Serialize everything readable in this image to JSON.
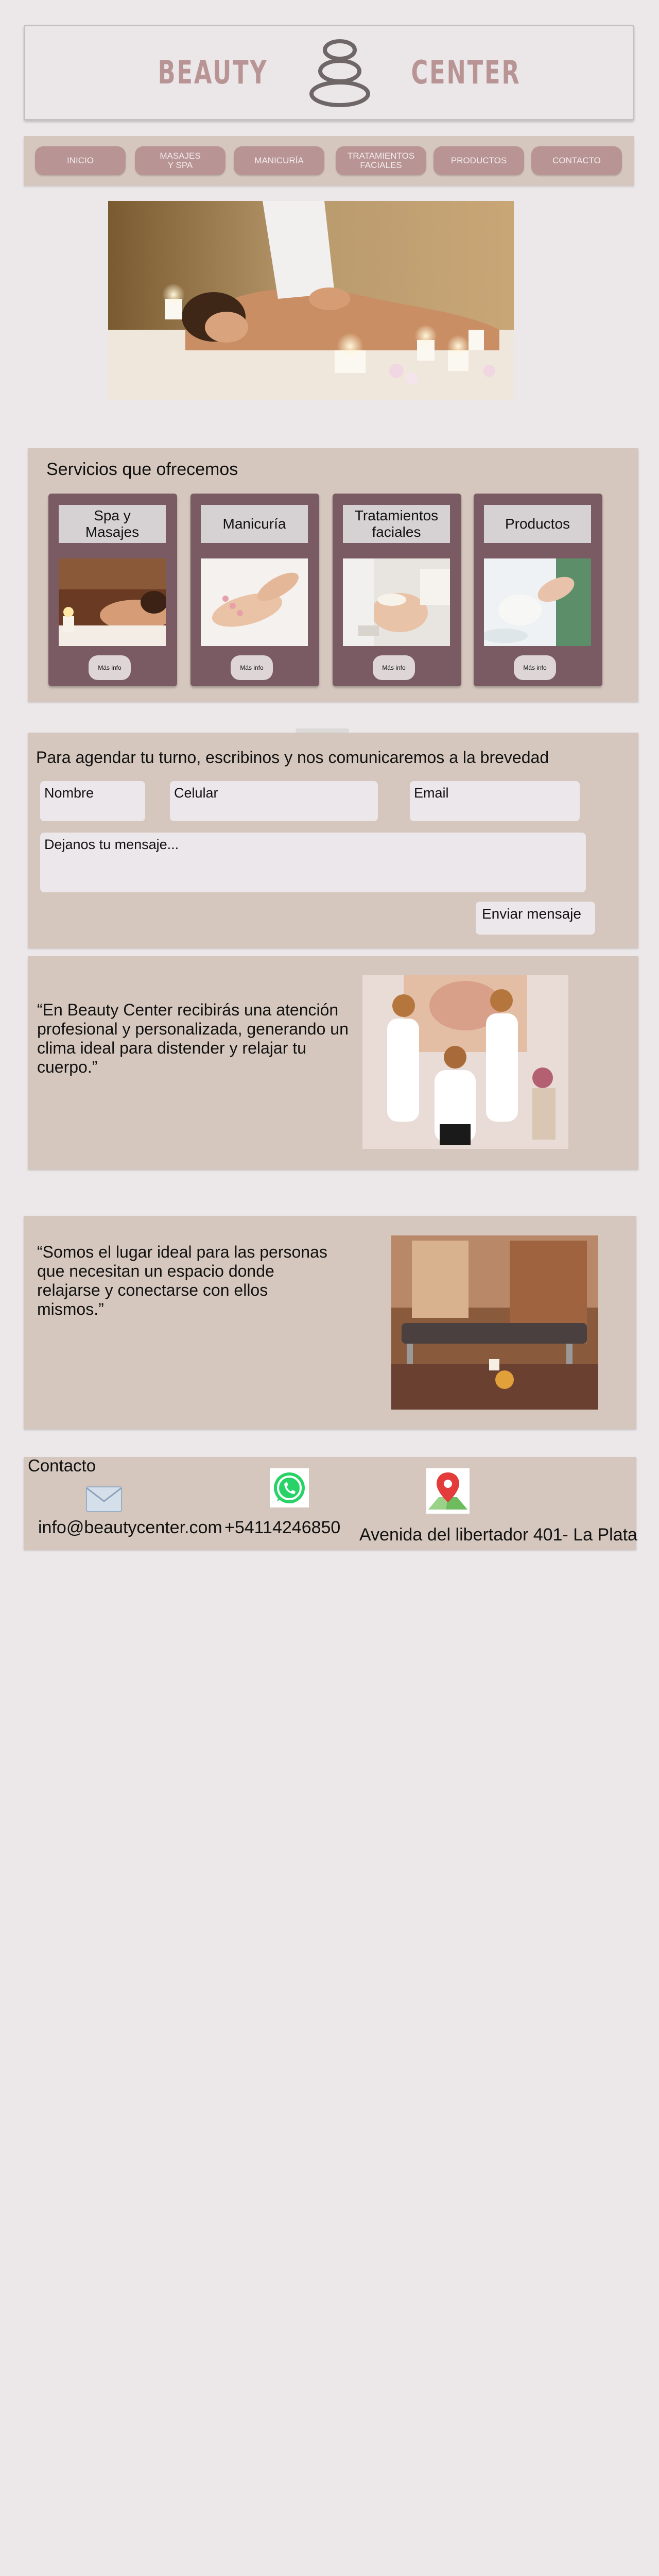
{
  "header": {
    "logo_left": "BEAUTY",
    "logo_right": "CENTER",
    "logo_color": "#b99495"
  },
  "nav": {
    "items": [
      {
        "label": "INICIO"
      },
      {
        "label": "MASAJES\nY SPA"
      },
      {
        "label": "MANICURÍA"
      },
      {
        "label": "TRATAMIENTOS\nFACIALES"
      },
      {
        "label": "PRODUCTOS"
      },
      {
        "label": "CONTACTO"
      }
    ],
    "button_color": "#b99495"
  },
  "services": {
    "title": "Servicios que ofrecemos",
    "cards": [
      {
        "title": "Spa y\nMasajes",
        "button": "Más info"
      },
      {
        "title": "Manicuría",
        "button": "Más info"
      },
      {
        "title": "Tratamientos\nfaciales",
        "button": "Más info"
      },
      {
        "title": "Productos",
        "button": "Más info"
      }
    ]
  },
  "form": {
    "title": "Para agendar tu turno, escribinos y nos comunicaremos a la brevedad",
    "name_placeholder": "Nombre",
    "phone_placeholder": "Celular",
    "email_placeholder": "Email",
    "message_placeholder": "Dejanos tu mensaje...",
    "send_label": "Enviar mensaje"
  },
  "quotes": {
    "first": "“En Beauty Center recibirás una atención profesional y personalizada, generando un clima ideal para distender y relajar tu cuerpo.”",
    "second": "“Somos el lugar ideal para las personas que necesitan un espacio donde relajarse y conectarse con ellos mismos.”"
  },
  "contact": {
    "title": "Contacto",
    "email": "info@beautycenter.com",
    "phone": "+54114246850",
    "address": "Avenida del libertador 401- La Plata"
  },
  "colors": {
    "page_bg": "#ece8ea",
    "section_bg": "#d5c7bd",
    "card_bg": "#7a5b63"
  }
}
